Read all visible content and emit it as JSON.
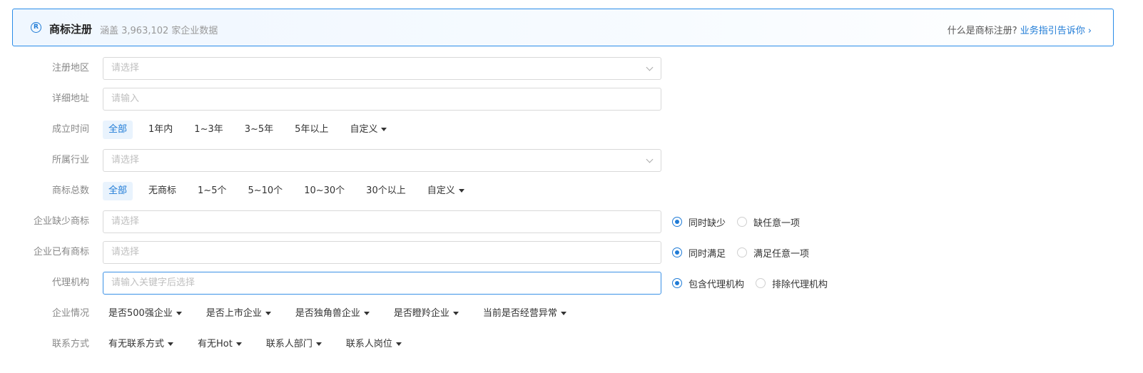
{
  "header": {
    "logo_glyph": "R",
    "title": "商标注册",
    "subtitle": "涵盖 3,963,102 家企业数据",
    "help_question": "什么是商标注册?",
    "help_link": "业务指引告诉你",
    "help_chevron": "›"
  },
  "form": {
    "region": {
      "label": "注册地区",
      "placeholder": "请选择"
    },
    "address": {
      "label": "详细地址",
      "placeholder": "请输入"
    },
    "founded": {
      "label": "成立时间",
      "options": [
        "全部",
        "1年内",
        "1~3年",
        "3~5年",
        "5年以上"
      ],
      "custom": "自定义"
    },
    "industry": {
      "label": "所属行业",
      "placeholder": "请选择"
    },
    "tm_total": {
      "label": "商标总数",
      "options": [
        "全部",
        "无商标",
        "1~5个",
        "5~10个",
        "10~30个",
        "30个以上"
      ],
      "custom": "自定义"
    },
    "tm_missing": {
      "label": "企业缺少商标",
      "placeholder": "请选择",
      "radios": [
        "同时缺少",
        "缺任意一项"
      ]
    },
    "tm_owned": {
      "label": "企业已有商标",
      "placeholder": "请选择",
      "radios": [
        "同时满足",
        "满足任意一项"
      ]
    },
    "agency": {
      "label": "代理机构",
      "placeholder": "请输入关键字后选择",
      "radios": [
        "包含代理机构",
        "排除代理机构"
      ]
    },
    "company": {
      "label": "企业情况",
      "dropdowns": [
        "是否500强企业",
        "是否上市企业",
        "是否独角兽企业",
        "是否瞪羚企业",
        "当前是否经营异常"
      ]
    },
    "contact": {
      "label": "联系方式",
      "dropdowns": [
        "有无联系方式",
        "有无Hot",
        "联系人部门",
        "联系人岗位"
      ]
    }
  },
  "colors": {
    "accent": "#1f7bd6",
    "active_bg": "#e9f3fd",
    "label": "#888888",
    "placeholder": "#bfbfbf"
  }
}
